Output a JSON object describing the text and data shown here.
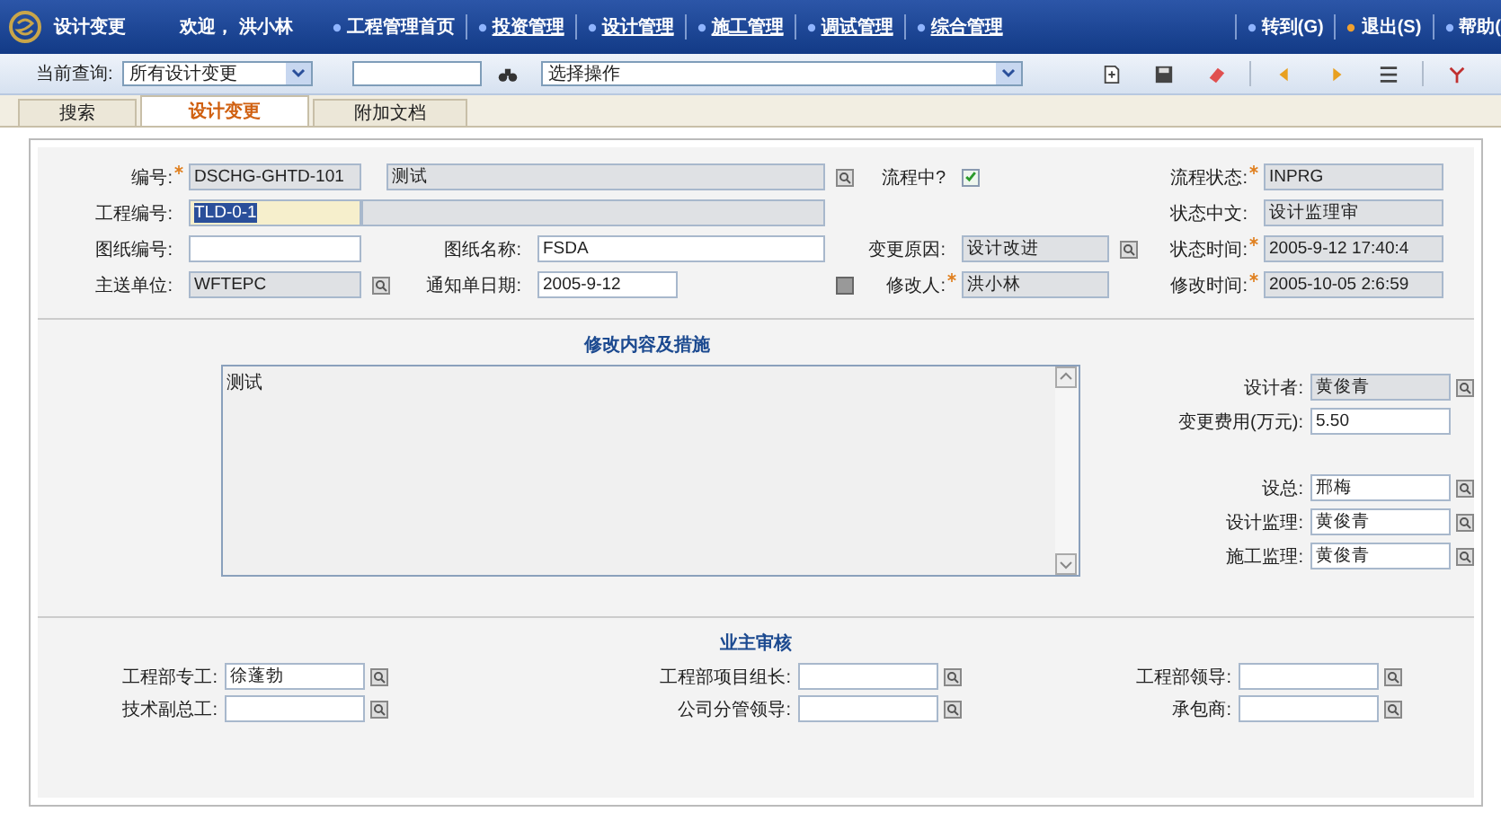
{
  "header": {
    "app_title": "设计变更",
    "welcome": "欢迎， 洪小林",
    "nav": [
      {
        "label": "工程管理首页",
        "underlined": false
      },
      {
        "label": "投资管理",
        "underlined": true
      },
      {
        "label": "设计管理",
        "underlined": true
      },
      {
        "label": "施工管理",
        "underlined": true
      },
      {
        "label": "调试管理",
        "underlined": true
      },
      {
        "label": "综合管理",
        "underlined": true
      }
    ],
    "links": [
      {
        "label": "转到(G)",
        "color": "#8fb4ff"
      },
      {
        "label": "退出(S)",
        "color": "#f0a030"
      },
      {
        "label": "帮助(",
        "color": "#8fb4ff"
      }
    ]
  },
  "toolbar": {
    "query_label": "当前查询:",
    "query_select": "所有设计变更",
    "action_select": "选择操作"
  },
  "tabs": [
    {
      "label": "搜索",
      "selected": false
    },
    {
      "label": "设计变更",
      "selected": true
    },
    {
      "label": "附加文档",
      "selected": false
    }
  ],
  "main_fields": [
    {
      "label": "编号:",
      "value": "DSCHG-GHTD-101",
      "kind": "text",
      "required": true,
      "readonly": true,
      "selected": false
    },
    {
      "value": "测试",
      "kind": "lookup",
      "readonly": true
    },
    {
      "label": "流程中?",
      "checked": true,
      "kind": "checkbox",
      "required": false
    },
    {
      "label": "流程状态:",
      "value": "INPRG",
      "kind": "text",
      "required": true,
      "readonly": true,
      "selected": false
    },
    {
      "label": "工程编号:",
      "value": "TLD-0-1",
      "kind": "lookup",
      "required": false,
      "readonly": false,
      "selected": true
    },
    {
      "kind": "text",
      "readonly": true
    },
    {
      "label": "状态中文:",
      "value": "设计监理审",
      "kind": "text",
      "required": false,
      "readonly": true,
      "selected": false
    },
    {
      "label": "图纸编号:",
      "kind": "text",
      "required": false,
      "readonly": false
    },
    {
      "label": "图纸名称:",
      "value": "FSDA",
      "kind": "text",
      "required": false,
      "readonly": false,
      "selected": false
    },
    {
      "label": "变更原因:",
      "value": "设计改进",
      "kind": "lookup",
      "required": false,
      "readonly": true,
      "selected": false
    },
    {
      "label": "状态时间:",
      "value": "2005-9-12 17:40:4",
      "kind": "text",
      "required": true,
      "readonly": true,
      "selected": false
    },
    {
      "label": "主送单位:",
      "value": "WFTEPC",
      "kind": "lookup",
      "required": false,
      "readonly": true,
      "selected": false
    },
    {
      "label": "通知单日期:",
      "value": "2005-9-12",
      "kind": "date",
      "required": false,
      "readonly": false,
      "selected": false
    },
    {
      "label": "修改人:",
      "value": "洪小林",
      "kind": "text",
      "required": true,
      "readonly": true,
      "selected": false
    },
    {
      "label": "修改时间:",
      "value": "2005-10-05 2:6:59",
      "kind": "text",
      "required": true,
      "readonly": true,
      "selected": false
    }
  ],
  "changes": {
    "title": "修改内容及措施",
    "content": "测试",
    "fields": [
      {
        "label": "设计者:",
        "value": "黄俊青",
        "kind": "lookup",
        "readonly": true
      },
      {
        "label": "变更费用(万元):",
        "value": "5.50",
        "kind": "text",
        "readonly": false
      },
      {
        "label": "设总:",
        "value": "邢梅",
        "kind": "lookup",
        "readonly": false
      },
      {
        "label": "设计监理:",
        "value": "黄俊青",
        "kind": "lookup",
        "readonly": false
      },
      {
        "label": "施工监理:",
        "value": "黄俊青",
        "kind": "lookup",
        "readonly": false
      }
    ]
  },
  "review": {
    "title": "业主审核",
    "fields": [
      {
        "label": "工程部专工:",
        "value": "徐蓬勃"
      },
      {
        "label": "工程部项目组长:"
      },
      {
        "label": "工程部领导:"
      },
      {
        "label": "技术副总工:"
      },
      {
        "label": "公司分管领导:"
      },
      {
        "label": "承包商:"
      }
    ]
  }
}
